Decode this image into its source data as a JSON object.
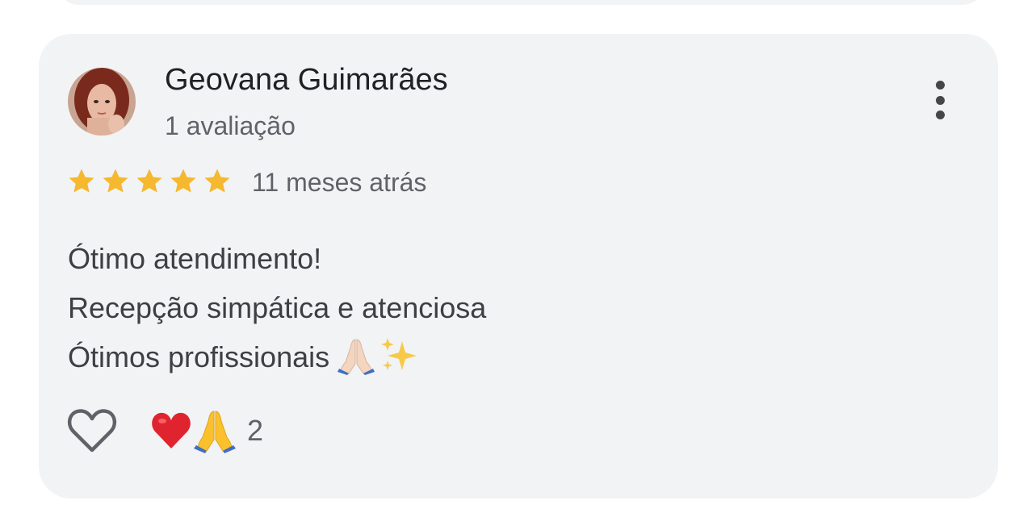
{
  "review": {
    "author_name": "Geovana Guimarães",
    "author_review_count": "1 avaliação",
    "avatar": "avatar-photo",
    "rating": 5,
    "rating_max": 5,
    "time_ago": "11 meses atrás",
    "text_lines": [
      "Ótimo atendimento!",
      "Recepção simpática e atenciosa",
      "Ótimos profissionais"
    ],
    "text_trailing_emojis": [
      "folded-hands-emoji",
      "sparkles-emoji"
    ],
    "reactions": {
      "emojis": [
        "red-heart-emoji",
        "folded-hands-emoji"
      ],
      "count": "2"
    },
    "icons": {
      "more": "more-vertical-icon",
      "like": "heart-outline-icon",
      "star": "star-icon"
    }
  },
  "colors": {
    "card_background": "#f2f3f5",
    "star": "#f5b82e",
    "primary_text": "#202124",
    "secondary_text": "#5f6368"
  }
}
